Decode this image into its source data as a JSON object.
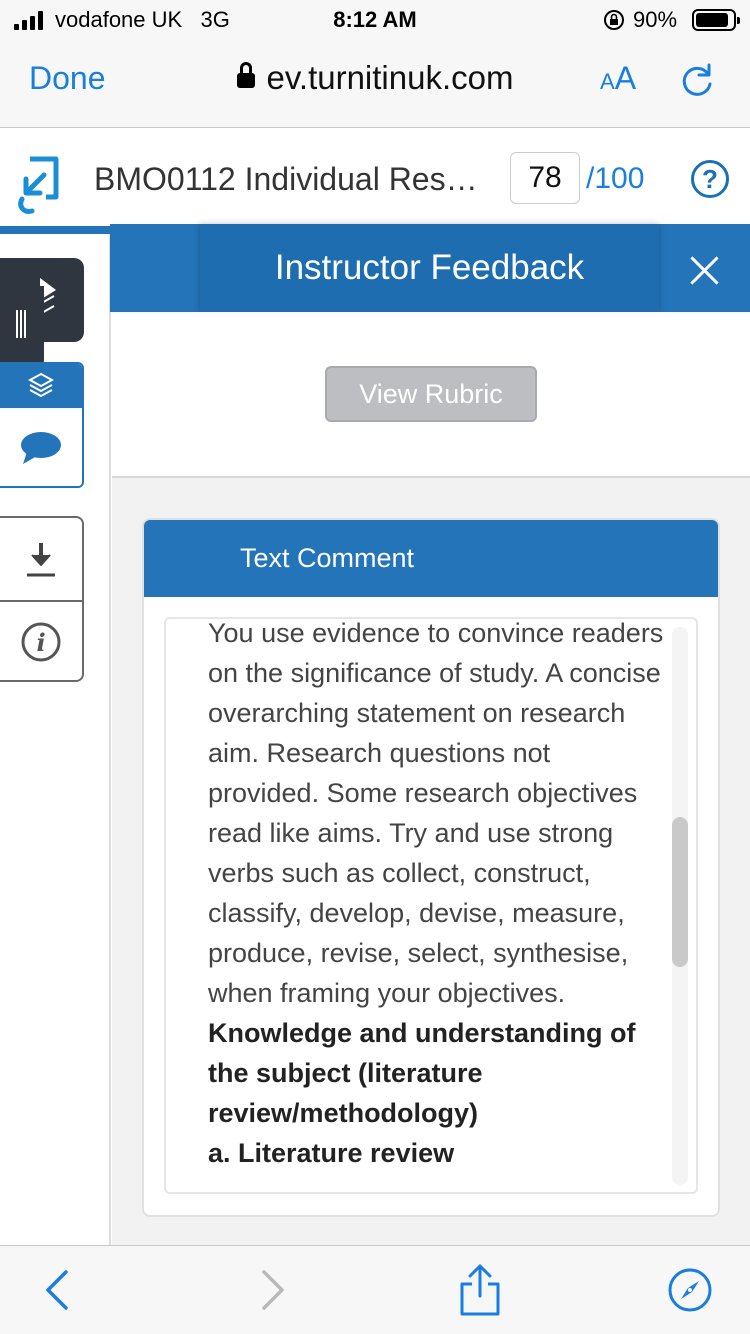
{
  "status_bar": {
    "carrier": "vodafone UK",
    "network": "3G",
    "time": "8:12 AM",
    "battery": "90%",
    "battery_level": 0.9
  },
  "browser": {
    "done_label": "Done",
    "url": "ev.turnitinuk.com",
    "text_size_small": "A",
    "text_size_large": "A"
  },
  "header": {
    "document_title": "BMO0112 Individual Resea…",
    "score": "78",
    "score_max": "/100",
    "help_label": "?"
  },
  "feedback": {
    "title": "Instructor Feedback",
    "view_rubric_label": "View Rubric",
    "comment_heading": "Text Comment",
    "comment_lines": [
      "You use evidence to convince readers on the significance of study. A concise overarching statement on research aim. Research questions not provided.  Some research objectives read like aims. Try and use strong verbs such as collect, construct, classify, develop, devise, measure, produce, revise, select, synthesise, when framing your objectives."
    ],
    "comment_bold": "Knowledge and understanding of the subject (literature review/methodology)",
    "comment_bold_cut": "a. Literature review"
  },
  "colors": {
    "accent_blue": "#2374b8",
    "link_blue": "#1a7de0",
    "sidebar_dark": "#2f3640"
  },
  "icons": [
    "lock-icon",
    "reload-icon",
    "turnitin-logo-icon",
    "help-icon",
    "expand-icon",
    "grip-icon",
    "layers-icon",
    "comment-icon",
    "download-icon",
    "info-icon",
    "close-icon",
    "back-icon",
    "forward-icon",
    "share-icon",
    "compass-icon"
  ]
}
